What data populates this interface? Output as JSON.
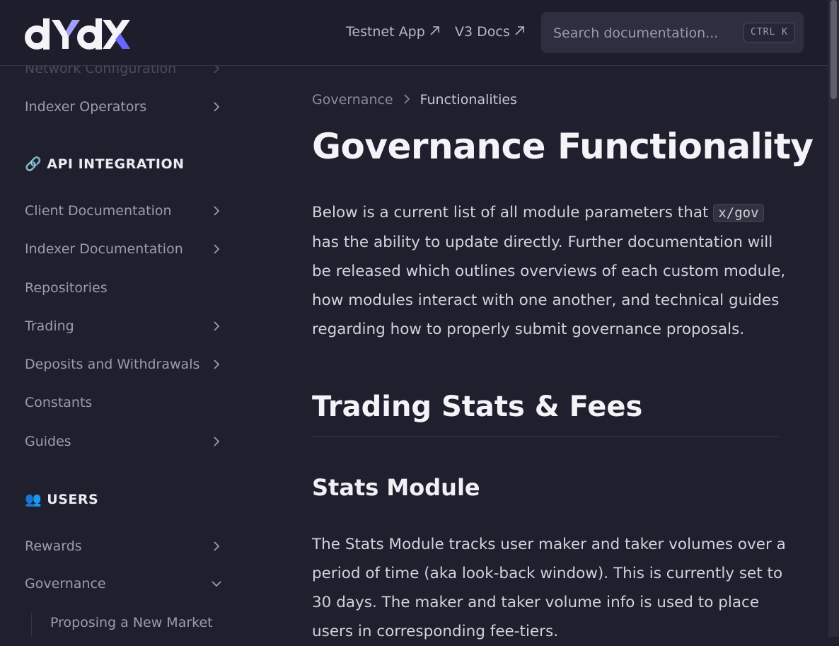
{
  "header": {
    "logo_text": "dYdX",
    "nav": [
      {
        "label": "Testnet App",
        "icon": "external-arrow-icon"
      },
      {
        "label": "V3 Docs",
        "icon": "external-arrow-icon"
      }
    ],
    "search": {
      "placeholder": "Search documentation...",
      "shortcut": "CTRL K"
    }
  },
  "sidebar": {
    "faded_item": "Network Configuration",
    "items_top": [
      {
        "label": "Indexer Operators",
        "chevron": "right"
      }
    ],
    "section_api": {
      "emoji": "🔗",
      "label": "API INTEGRATION"
    },
    "api_items": [
      {
        "label": "Client Documentation",
        "chevron": "right"
      },
      {
        "label": "Indexer Documentation",
        "chevron": "right"
      },
      {
        "label": "Repositories",
        "chevron": "none"
      },
      {
        "label": "Trading",
        "chevron": "right"
      },
      {
        "label": "Deposits and Withdrawals",
        "chevron": "right"
      },
      {
        "label": "Constants",
        "chevron": "none"
      },
      {
        "label": "Guides",
        "chevron": "right"
      }
    ],
    "section_users": {
      "emoji": "👥",
      "label": "USERS"
    },
    "user_items": [
      {
        "label": "Rewards",
        "chevron": "right"
      },
      {
        "label": "Governance",
        "chevron": "down"
      }
    ],
    "sub_items": [
      {
        "label": "Proposing a New Market"
      }
    ]
  },
  "main": {
    "breadcrumb": {
      "parent": "Governance",
      "current": "Functionalities"
    },
    "title": "Governance Functionality",
    "intro": {
      "before_code": "Below is a current list of all module parameters that",
      "code": "x/gov",
      "after_code": "has the ability to update directly. Further documentation will be released which outlines overviews of each custom module, how modules interact with one another, and technical guides regarding how to properly submit governance proposals."
    },
    "section_title": "Trading Stats & Fees",
    "subsection_title": "Stats Module",
    "stats_paragraph": "The Stats Module tracks user maker and taker volumes over a period of time (aka look-back window). This is currently set to 30 days. The maker and taker volume info is used to place users in corresponding fee-tiers."
  },
  "colors": {
    "background": "#1f1f2d",
    "header_bg": "#1d1d2b",
    "brand_purple": "#6966ff",
    "text_primary": "#f4f4f8",
    "text_muted": "#9c9cb0"
  }
}
